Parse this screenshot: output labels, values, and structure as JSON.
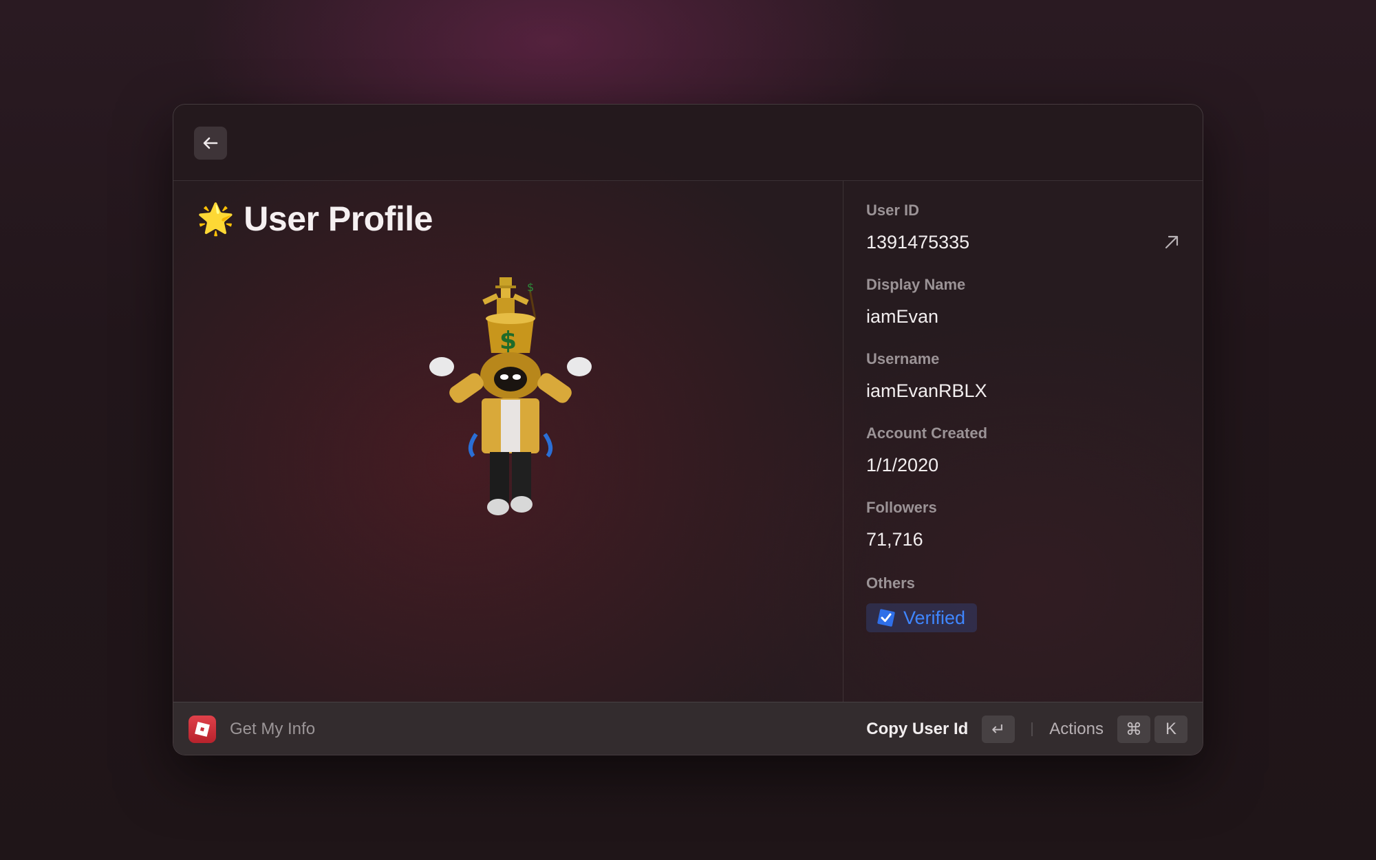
{
  "header": {
    "back_icon": "arrow-left-icon"
  },
  "main": {
    "title_emoji": "🌟",
    "title": "User Profile",
    "avatar_icon": "roblox-avatar-image"
  },
  "details": {
    "user_id_label": "User ID",
    "user_id": "1391475335",
    "display_name_label": "Display Name",
    "display_name": "iamEvan",
    "username_label": "Username",
    "username": "iamEvanRBLX",
    "created_label": "Account Created",
    "created": "1/1/2020",
    "followers_label": "Followers",
    "followers": "71,716",
    "others_label": "Others",
    "badge": "Verified",
    "badge_color": "#3f86ff"
  },
  "footer": {
    "app_name": "Get My Info",
    "primary_action": "Copy User Id",
    "enter_key": "↵",
    "actions_label": "Actions",
    "cmd_key": "⌘",
    "k_key": "K"
  }
}
